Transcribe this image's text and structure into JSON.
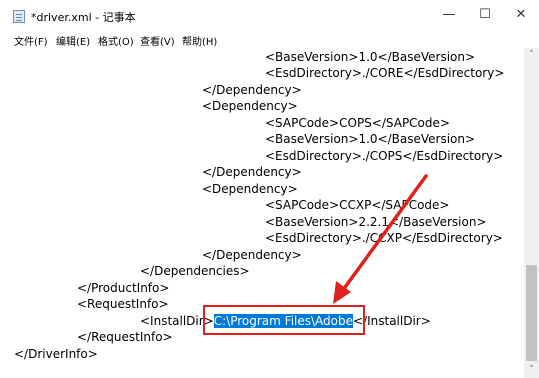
{
  "window": {
    "title": "*driver.xml - 记事本",
    "minimize_glyph": "—",
    "maximize_glyph": "☐",
    "close_glyph": "✕"
  },
  "menu": {
    "items": [
      "文件(F)",
      "编辑(E)",
      "格式(O)",
      "查看(V)",
      "帮助(H)"
    ]
  },
  "editor": {
    "lines": [
      "<BaseVersion>1.0</BaseVersion>",
      "<EsdDirectory>./CORE</EsdDirectory>",
      "</Dependency>",
      "<Dependency>",
      "<SAPCode>COPS</SAPCode>",
      "<BaseVersion>1.0</BaseVersion>",
      "<EsdDirectory>./COPS</EsdDirectory>",
      "</Dependency>",
      "<Dependency>",
      "<SAPCode>CCXP</SAPCode>",
      "<BaseVersion>2.2.1</BaseVersion>",
      "<EsdDirectory>./CCXP</EsdDirectory>",
      "</Dependency>",
      "</Dependencies>",
      "</ProductInfo>",
      "<RequestInfo>",
      "</RequestInfo>",
      "</DriverInfo>"
    ],
    "install_dir_open": "<InstallDir>",
    "install_dir_value": "C:\\Program Files\\Adobe",
    "install_dir_close": "</InstallDir>"
  },
  "scrollbar": {
    "up_glyph": "˄",
    "down_glyph": "˅"
  },
  "annotation": {
    "color": "#e0201b"
  }
}
